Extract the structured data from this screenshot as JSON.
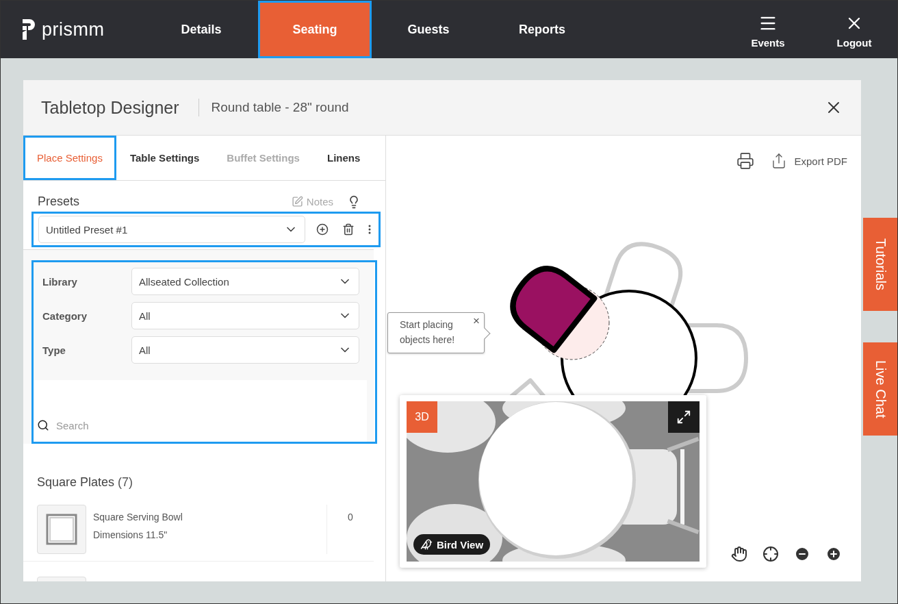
{
  "nav": {
    "brand": "prismm",
    "tabs": [
      {
        "label": "Details",
        "selected": false,
        "highlighted": false
      },
      {
        "label": "Seating",
        "selected": true,
        "highlighted": true
      },
      {
        "label": "Guests",
        "selected": false,
        "highlighted": false
      },
      {
        "label": "Reports",
        "selected": false,
        "highlighted": false
      }
    ],
    "actions": [
      {
        "label": "Events",
        "kind": "menu"
      },
      {
        "label": "Logout",
        "kind": "close"
      }
    ]
  },
  "dialog": {
    "title": "Tabletop Designer",
    "subtitle": "Round table - 28\" round",
    "tabs": [
      {
        "label": "Place Settings",
        "selected": true,
        "disabled": false,
        "highlighted": true
      },
      {
        "label": "Table Settings",
        "selected": false,
        "disabled": false,
        "highlighted": false
      },
      {
        "label": "Buffet Settings",
        "selected": false,
        "disabled": true,
        "highlighted": false
      },
      {
        "label": "Linens",
        "selected": false,
        "disabled": false,
        "highlighted": false
      }
    ],
    "presets": {
      "title": "Presets",
      "notes": "Notes",
      "value": "Untitled Preset #1",
      "highlighted": true
    },
    "filters": {
      "highlighted": true,
      "fields": [
        {
          "label": "Library",
          "value": "Allseated Collection"
        },
        {
          "label": "Category",
          "value": "All"
        },
        {
          "label": "Type",
          "value": "All"
        }
      ],
      "search": {
        "placeholder": "Search"
      }
    },
    "section": {
      "title": "Square Plates",
      "count": "(7)",
      "items": [
        {
          "name": "Square Serving Bowl",
          "detail": "Dimensions 11.5\"",
          "count": "0"
        }
      ]
    },
    "toolbar": {
      "export": "Export PDF"
    },
    "tooltip": {
      "text": "Start placing objects here!",
      "close": "×"
    },
    "preview": {
      "badge": "3D",
      "view": "Bird View"
    }
  },
  "side_tabs": [
    "Tutorials",
    "Live Chat"
  ]
}
